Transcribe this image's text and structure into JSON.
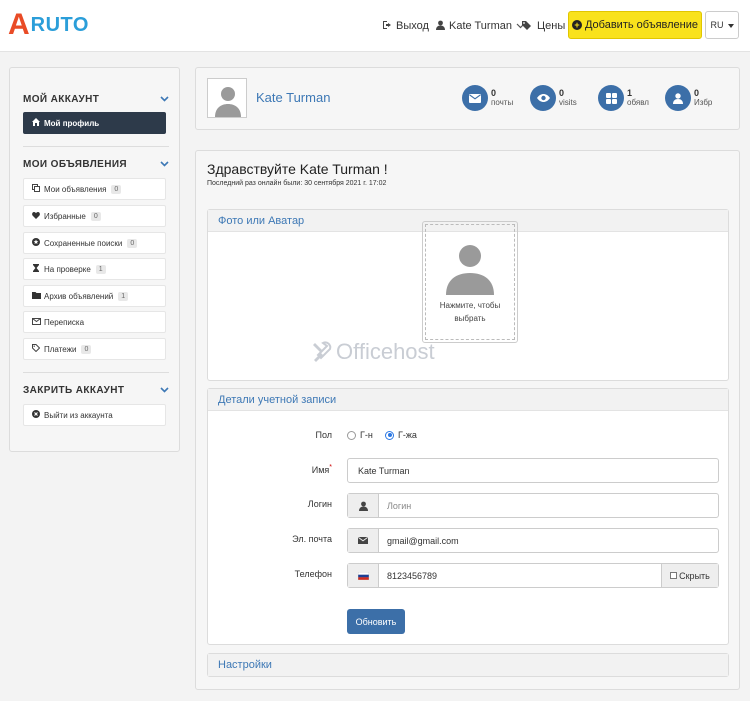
{
  "header": {
    "logo_a": "A",
    "logo_text": "RUTO",
    "logout_label": "Выход",
    "user_label": "Kate Turman",
    "prices_label": "Цены",
    "add_button_label": "Добавить объявление",
    "lang": "RU",
    "accent": "#f9e21c"
  },
  "sidebar": {
    "section_account": "МОЙ АККАУНТ",
    "profile_item": "Мой профиль",
    "section_ads": "МОИ ОБЪЯВЛЕНИЯ",
    "ads_items": [
      {
        "label": "Мои объявления",
        "count": "0",
        "icon": "copy-icon"
      },
      {
        "label": "Избранные",
        "count": "0",
        "icon": "heart-icon"
      },
      {
        "label": "Сохраненные поиски",
        "count": "0",
        "icon": "star-icon"
      },
      {
        "label": "На проверке",
        "count": "1",
        "icon": "hourglass-icon"
      },
      {
        "label": "Архив объявлений",
        "count": "1",
        "icon": "folder-icon"
      },
      {
        "label": "Переписка",
        "count": "",
        "icon": "envelope-icon"
      },
      {
        "label": "Платежи",
        "count": "0",
        "icon": "tag-icon"
      }
    ],
    "section_close": "ЗАКРИТЬ АККАУНТ",
    "logout_item": "Выйти из аккаунта"
  },
  "profile": {
    "name": "Kate Turman",
    "stats": [
      {
        "num": "0",
        "label": "почты",
        "icon": "envelope-icon"
      },
      {
        "num": "0",
        "label": "visits",
        "icon": "eye-icon"
      },
      {
        "num": "1",
        "label": "обявл",
        "icon": "grid-icon"
      },
      {
        "num": "0",
        "label": "Избр",
        "icon": "user-icon"
      }
    ]
  },
  "main": {
    "greeting": "Здравствуйте Kate Turman !",
    "last_seen": "Последний раз онлайн были: 30 сентября 2021 г. 17:02",
    "photo_panel_title": "Фото или Аватар",
    "dropzone_text": "Нажмите, чтобы выбрать",
    "details_panel_title": "Детали учетной записи",
    "settings_panel_title": "Настройки",
    "watermark": "Officehost"
  },
  "form": {
    "gender_label": "Пол",
    "gender_options": [
      "Г-н",
      "Г-жа"
    ],
    "gender_selected": "Г-жа",
    "name_label": "Имя",
    "name_required_mark": "*",
    "name_value": "Kate Turman",
    "login_label": "Логин",
    "login_placeholder": "Логин",
    "email_label": "Эл. почта",
    "email_value": "gmail@gmail.com",
    "phone_label": "Телефон",
    "phone_value": "8123456789",
    "hide_label": "Скрыть",
    "update_button": "Обновить"
  }
}
